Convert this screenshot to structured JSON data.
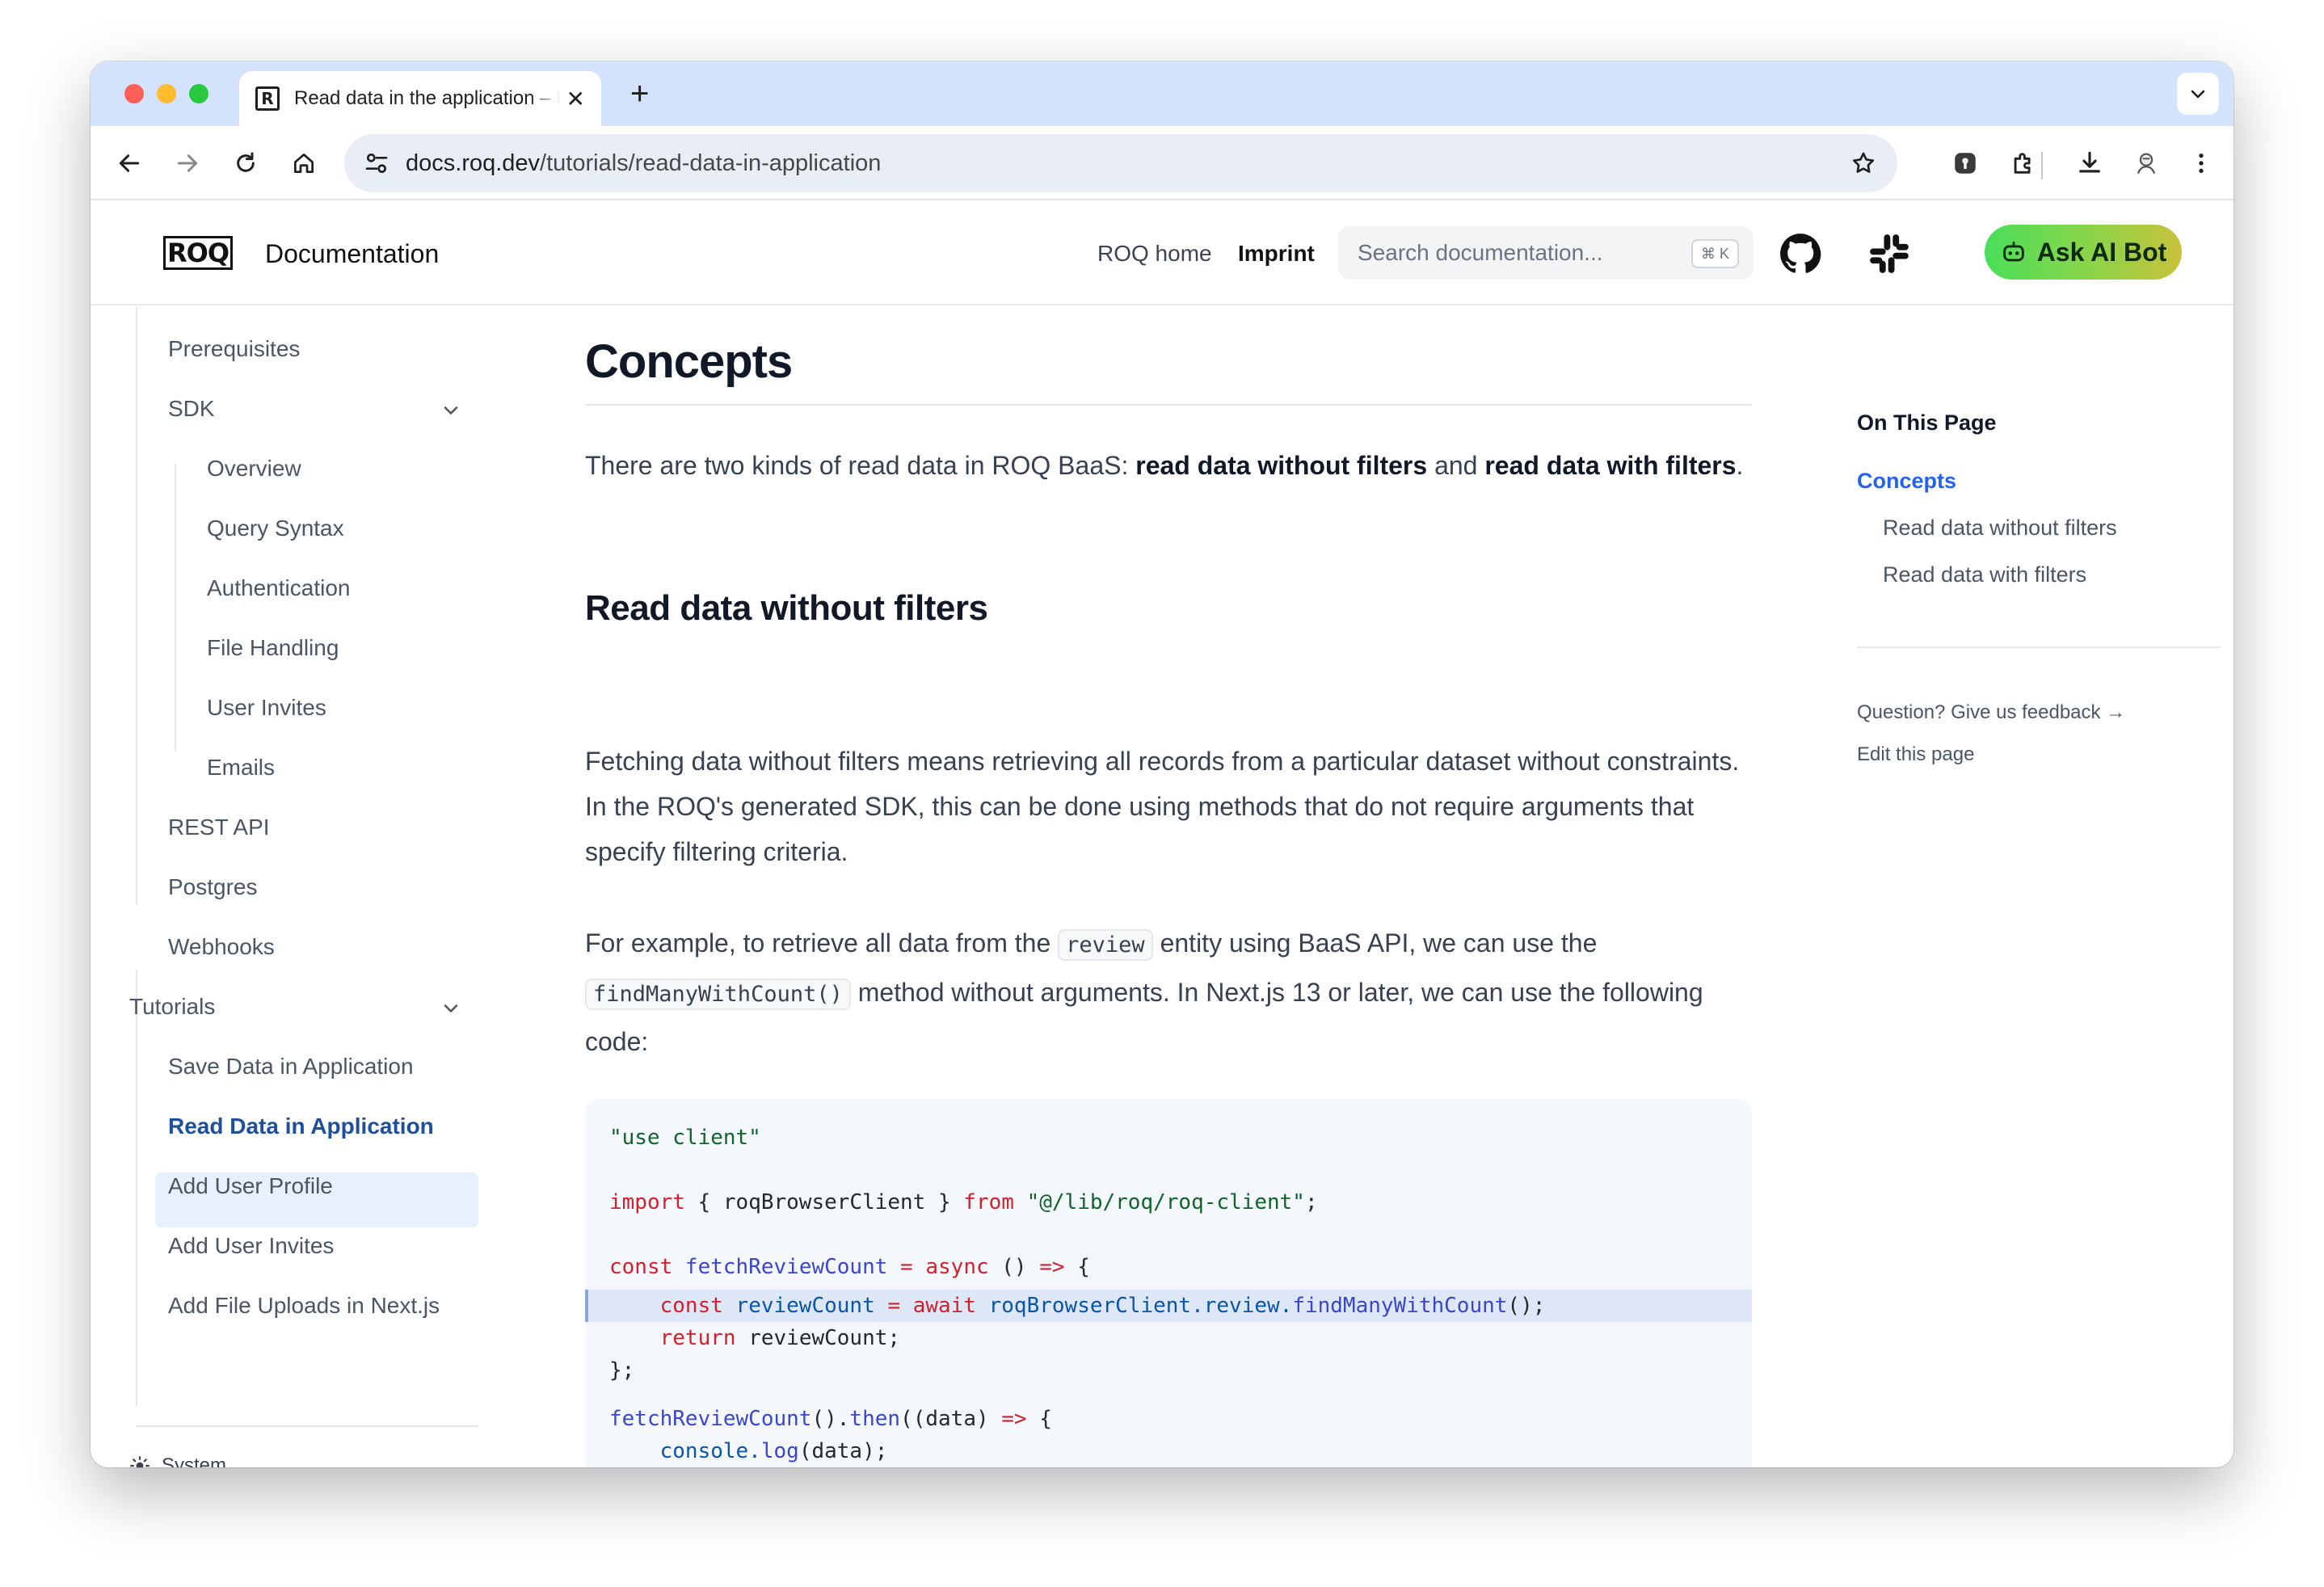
{
  "browser": {
    "tab_title": "Read data in the application – ROQ Docs",
    "tab_close": "✕",
    "new_tab": "+",
    "url_host": "docs.roq.dev",
    "url_path": "/tutorials/read-data-in-application"
  },
  "header": {
    "logo_text": "ROQ",
    "doc_title": "Documentation",
    "nav_roq_home": "ROQ home",
    "nav_imprint": "Imprint",
    "search_placeholder": "Search documentation...",
    "search_shortcut": "⌘ K",
    "ai_button_label": "Ask AI Bot",
    "ai_button_color": "#4ade5a"
  },
  "sidebar": {
    "prerequisites": "Prerequisites",
    "sdk": "SDK",
    "sdk_items": [
      "Overview",
      "Query Syntax",
      "Authentication",
      "File Handling",
      "User Invites",
      "Emails"
    ],
    "rest_api": "REST API",
    "postgres": "Postgres",
    "webhooks": "Webhooks",
    "tutorials": "Tutorials",
    "tutorial_items": [
      "Save Data in Application",
      "Read Data in Application",
      "Add User Profile",
      "Add User Invites",
      "Add File Uploads in Next.js"
    ],
    "active_item": "Read Data in Application",
    "theme_label": "System"
  },
  "main": {
    "h1": "Concepts",
    "intro_prefix": "There are two kinds of read data in ROQ BaaS: ",
    "intro_bold1": "read data without filters",
    "intro_mid": " and ",
    "intro_bold2": "read data with filters",
    "intro_suffix": ".",
    "h2": "Read data without filters",
    "para1": "Fetching data without filters means retrieving all records from a particular dataset without constraints. In the ROQ's generated SDK, this can be done using methods that do not require arguments that specify filtering criteria.",
    "para2_prefix": "For example, to retrieve all data from the ",
    "para2_code1": "review",
    "para2_mid": " entity using BaaS API, we can use the ",
    "para2_code2": "findManyWithCount()",
    "para2_suffix": " method without arguments. In Next.js 13 or later, we can use the following code:"
  },
  "code": {
    "l1": "\"use client\"",
    "l3_a": "import",
    "l3_b": " { roqBrowserClient } ",
    "l3_c": "from",
    "l3_d": " \"@/lib/roq/roq-client\"",
    "l3_e": ";",
    "l5_a": "const",
    "l5_b": " fetchReviewCount",
    "l5_c": " =",
    "l5_d": " async",
    "l5_e": " () ",
    "l5_f": "=>",
    "l5_g": " {",
    "l6_a": "    const",
    "l6_b": " reviewCount",
    "l6_c": " =",
    "l6_d": " await",
    "l6_e": " roqBrowserClient.review.",
    "l6_f": "findManyWithCount",
    "l6_g": "();",
    "l7_a": "    return",
    "l7_b": " reviewCount;",
    "l8": "};",
    "l10_a": "fetchReviewCount",
    "l10_b": "().",
    "l10_c": "then",
    "l10_d": "((data) ",
    "l10_e": "=>",
    "l10_f": " {",
    "l11_a": "    console.",
    "l11_b": "log",
    "l11_c": "(data);",
    "l12": "});"
  },
  "toc": {
    "title": "On This Page",
    "items": [
      "Concepts",
      "Read data without filters",
      "Read data with filters"
    ],
    "feedback": "Question? Give us feedback →",
    "edit": "Edit this page"
  },
  "icons": {
    "back": "arrow-left-icon",
    "forward": "arrow-right-icon",
    "reload": "reload-icon",
    "home": "home-icon",
    "star": "star-icon",
    "github": "github-icon",
    "slack": "slack-icon",
    "sun": "sun-icon"
  }
}
